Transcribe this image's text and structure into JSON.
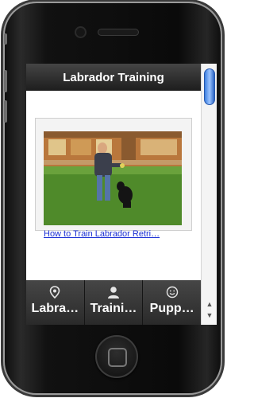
{
  "app": {
    "title": "Labrador Training"
  },
  "video_list": {
    "items": [
      {
        "caption": "How to Train Labrador Retri…"
      }
    ]
  },
  "tabs": [
    {
      "label": "Labra…",
      "icon": "location-pin-icon"
    },
    {
      "label": "Traini…",
      "icon": "person-icon"
    },
    {
      "label": "Pupp…",
      "icon": "smiley-icon"
    }
  ],
  "scrollbar": {
    "up_arrow": "▲",
    "down_arrow": "▼"
  },
  "colors": {
    "accent": "#3c7fe0",
    "link": "#1a2fd4"
  }
}
